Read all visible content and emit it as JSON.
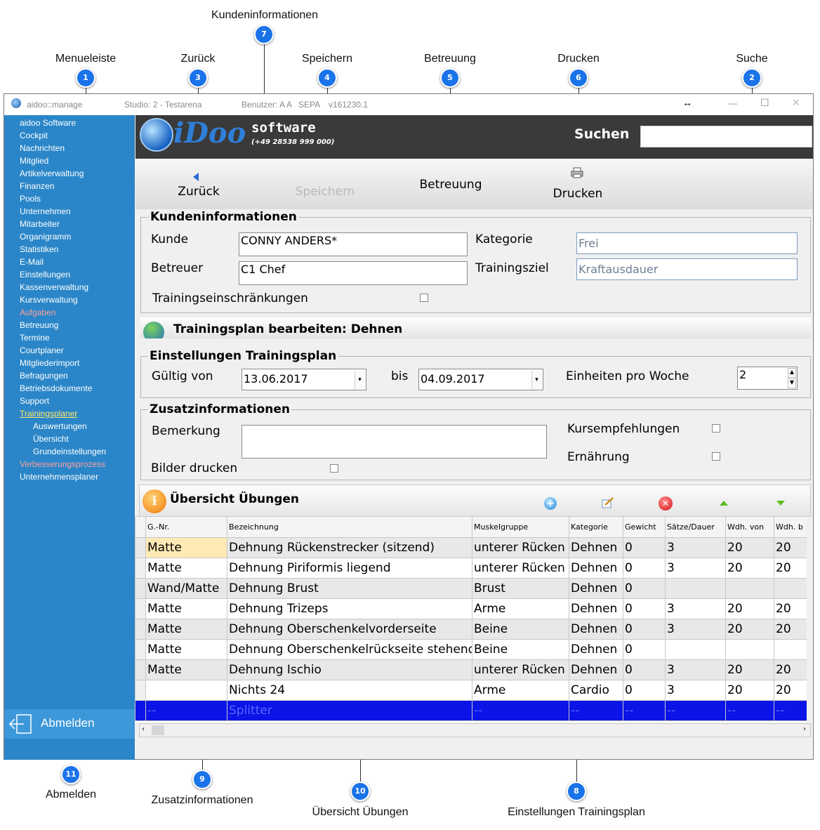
{
  "callouts": [
    {
      "num": "1",
      "label": "Menueleiste"
    },
    {
      "num": "2",
      "label": "Suche"
    },
    {
      "num": "3",
      "label": "Zurück"
    },
    {
      "num": "4",
      "label": "Speichern"
    },
    {
      "num": "5",
      "label": "Betreuung"
    },
    {
      "num": "6",
      "label": "Drucken"
    },
    {
      "num": "7",
      "label": "Kundeninformationen"
    },
    {
      "num": "8",
      "label": "Einstellungen Trainingsplan"
    },
    {
      "num": "9",
      "label": "Zusatzinformationen"
    },
    {
      "num": "10",
      "label": "Übersicht Übungen"
    },
    {
      "num": "11",
      "label": "Abmelden"
    }
  ],
  "titlebar": {
    "app": "aidoo::manage",
    "studio": "Studio: 2 - Testarena",
    "user": "Benutzer: A A",
    "sepa": "SEPA",
    "version": "v161230.1",
    "resize_glyph": "↔",
    "min_glyph": "—",
    "max_glyph": "☐",
    "close_glyph": "✕"
  },
  "sidebar": {
    "items": [
      {
        "label": "aidoo Software",
        "state": "normal"
      },
      {
        "label": "Cockpit",
        "state": "normal"
      },
      {
        "label": "Nachrichten",
        "state": "normal"
      },
      {
        "label": "Mitglied",
        "state": "normal"
      },
      {
        "label": "Artikelverwaltung",
        "state": "normal"
      },
      {
        "label": "Finanzen",
        "state": "normal"
      },
      {
        "label": "Pools",
        "state": "normal"
      },
      {
        "label": "Unternehmen",
        "state": "normal"
      },
      {
        "label": "Mitarbeiter",
        "state": "normal"
      },
      {
        "label": "Organigramm",
        "state": "normal"
      },
      {
        "label": "Statistiken",
        "state": "normal"
      },
      {
        "label": "E-Mail",
        "state": "normal"
      },
      {
        "label": "Einstellungen",
        "state": "normal"
      },
      {
        "label": "Kassenverwaltung",
        "state": "normal"
      },
      {
        "label": "Kursverwaltung",
        "state": "normal"
      },
      {
        "label": "Aufgaben",
        "state": "red"
      },
      {
        "label": "Betreuung",
        "state": "normal"
      },
      {
        "label": "Termine",
        "state": "normal"
      },
      {
        "label": "Courtplaner",
        "state": "normal"
      },
      {
        "label": "Mitgliederimport",
        "state": "normal"
      },
      {
        "label": "Befragungen",
        "state": "normal"
      },
      {
        "label": "Betriebsdokumente",
        "state": "normal"
      },
      {
        "label": "Support",
        "state": "normal"
      },
      {
        "label": "Trainingsplaner",
        "state": "active"
      },
      {
        "label": "Auswertungen",
        "state": "sub"
      },
      {
        "label": "Übersicht",
        "state": "sub"
      },
      {
        "label": "Grundeinstellungen",
        "state": "sub"
      },
      {
        "label": "Verbesserungsprozess",
        "state": "red"
      },
      {
        "label": "Unternehmensplaner",
        "state": "normal"
      }
    ],
    "logout_label": "Abmelden"
  },
  "header": {
    "logo_text": "iDoo",
    "logo_software": "software",
    "logo_phone": "(+49 28538 999 000)",
    "search_label": "Suchen",
    "search_value": ""
  },
  "toolbar": {
    "back": "Zurück",
    "save": "Speichern",
    "care": "Betreuung",
    "print": "Drucken"
  },
  "customer": {
    "title": "Kundeninformationen",
    "kunde_label": "Kunde",
    "kunde_value": "CONNY ANDERS*",
    "betreuer_label": "Betreuer",
    "betreuer_value": "C1 Chef",
    "kategorie_label": "Kategorie",
    "kategorie_value": "Frei",
    "ziel_label": "Trainingsziel",
    "ziel_value": "Kraftausdauer",
    "einschr_label": "Trainingseinschränkungen"
  },
  "plan_header": "Trainingsplan bearbeiten: Dehnen",
  "settings": {
    "title": "Einstellungen Trainingsplan",
    "von_label": "Gültig von",
    "von_value": "13.06.2017",
    "bis_label": "bis",
    "bis_value": "04.09.2017",
    "einheiten_label": "Einheiten pro Woche",
    "einheiten_value": "2"
  },
  "extra": {
    "title": "Zusatzinformationen",
    "bemerkung_label": "Bemerkung",
    "bemerkung_value": "",
    "bilder_label": "Bilder drucken",
    "kurs_label": "Kursempfehlungen",
    "ernaehrung_label": "Ernährung"
  },
  "exercises": {
    "title": "Übersicht Übungen",
    "columns": [
      "G.-Nr.",
      "Bezeichnung",
      "Muskelgruppe",
      "Kategorie",
      "Gewicht",
      "Sätze/Dauer",
      "Wdh. von",
      "Wdh. b"
    ],
    "rows": [
      [
        "Matte",
        "Dehnung Rückenstrecker (sitzend)",
        "unterer Rücken",
        "Dehnen",
        "0",
        "3",
        "20",
        "20"
      ],
      [
        "Matte",
        "Dehnung Piriformis liegend",
        "unterer Rücken",
        "Dehnen",
        "0",
        "3",
        "20",
        "20"
      ],
      [
        "Wand/Matte",
        "Dehnung Brust",
        "Brust",
        "Dehnen",
        "0",
        "",
        "",
        ""
      ],
      [
        "Matte",
        "Dehnung Trizeps",
        "Arme",
        "Dehnen",
        "0",
        "3",
        "20",
        "20"
      ],
      [
        "Matte",
        "Dehnung Oberschenkelvorderseite",
        "Beine",
        "Dehnen",
        "0",
        "3",
        "20",
        "20"
      ],
      [
        "Matte",
        "Dehnung Oberschenkelrückseite stehend",
        "Beine",
        "Dehnen",
        "0",
        "",
        "",
        ""
      ],
      [
        "Matte",
        "Dehnung Ischio",
        "unterer Rücken",
        "Dehnen",
        "0",
        "3",
        "20",
        "20"
      ],
      [
        "",
        "Nichts 24",
        "Arme",
        "Cardio",
        "0",
        "3",
        "20",
        "20"
      ],
      [
        "--",
        "Splitter",
        "--",
        "--",
        "--",
        "--",
        "--",
        "--"
      ]
    ]
  },
  "colors": {
    "sidebar": "#2a86c8",
    "badge": "#1a73e8",
    "selected_row": "#0a14e6",
    "active_nav": "#ffe66b",
    "red_nav": "#ff9f9f"
  }
}
